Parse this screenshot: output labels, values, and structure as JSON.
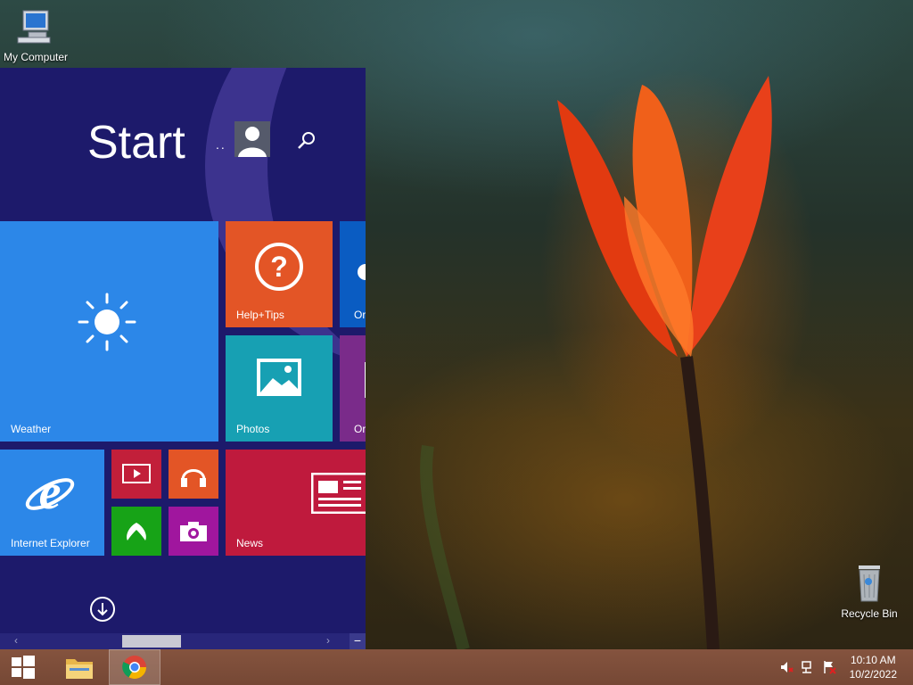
{
  "desktop": {
    "icons": [
      {
        "label": "My Computer"
      },
      {
        "label": "Recycle Bin"
      }
    ]
  },
  "start": {
    "title": "Start",
    "user_dots": "..",
    "tiles": {
      "weather": "Weather",
      "help": "Help+Tips",
      "onedrive_partial": "Or",
      "photos": "Photos",
      "onenote_partial": "Or",
      "ie": "Internet Explorer",
      "news": "News"
    },
    "scroll_position": 0.31
  },
  "taskbar": {
    "time": "10:10 AM",
    "date": "10/2/2022"
  },
  "colors": {
    "start_bg": "#1d1a6b",
    "weather": "#2c87e8",
    "help": "#e35526",
    "photos": "#17a0b3",
    "ie": "#2c87e8",
    "video": "#c21f3a",
    "music": "#e35526",
    "games": "#17a317",
    "camera": "#a0169e",
    "news": "#bf1a3d"
  }
}
